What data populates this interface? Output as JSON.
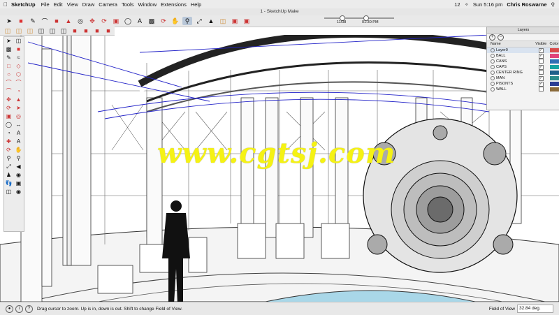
{
  "menubar": {
    "app": "SketchUp",
    "items": [
      "File",
      "Edit",
      "View",
      "Draw",
      "Camera",
      "Tools",
      "Window",
      "Extensions",
      "Help"
    ],
    "status_num": "12",
    "clock": "Sun 5:16 pm",
    "user": "Chris Roswarne"
  },
  "window": {
    "title": "1 - SketchUp Make"
  },
  "shadow_slider": {
    "left_label": "11/08",
    "right_label": "01:30 PM"
  },
  "layers_panel": {
    "title": "Layers",
    "col_name": "Name",
    "col_visible": "Visible",
    "col_color": "Color",
    "rows": [
      {
        "name": "Layer0",
        "color": "#d94a4a",
        "visible": true
      },
      {
        "name": "BALL",
        "color": "#e0447a",
        "visible": true
      },
      {
        "name": "CANS",
        "color": "#2e6fb4",
        "visible": false
      },
      {
        "name": "CAPS",
        "color": "#15a3a3",
        "visible": true
      },
      {
        "name": "CENTER RING",
        "color": "#1d5f8a",
        "visible": false
      },
      {
        "name": "MAN",
        "color": "#2b8b8b",
        "visible": true
      },
      {
        "name": "PISONTS",
        "color": "#2b3d93",
        "visible": true
      },
      {
        "name": "WALL",
        "color": "#8a6a3a",
        "visible": false
      }
    ]
  },
  "watermark": "www.cgtsj.com",
  "statusbar": {
    "hint": "Drag cursor to zoom.  Up is in, down is out.  Shift to change Field of View.",
    "vcb_label": "Field of View",
    "vcb_value": "32.84 deg."
  },
  "icons": [
    "apple-icon",
    "select-icon",
    "eraser-icon",
    "paint-icon",
    "pencil-icon",
    "orbit-icon",
    "pan-icon",
    "zoom-icon"
  ]
}
